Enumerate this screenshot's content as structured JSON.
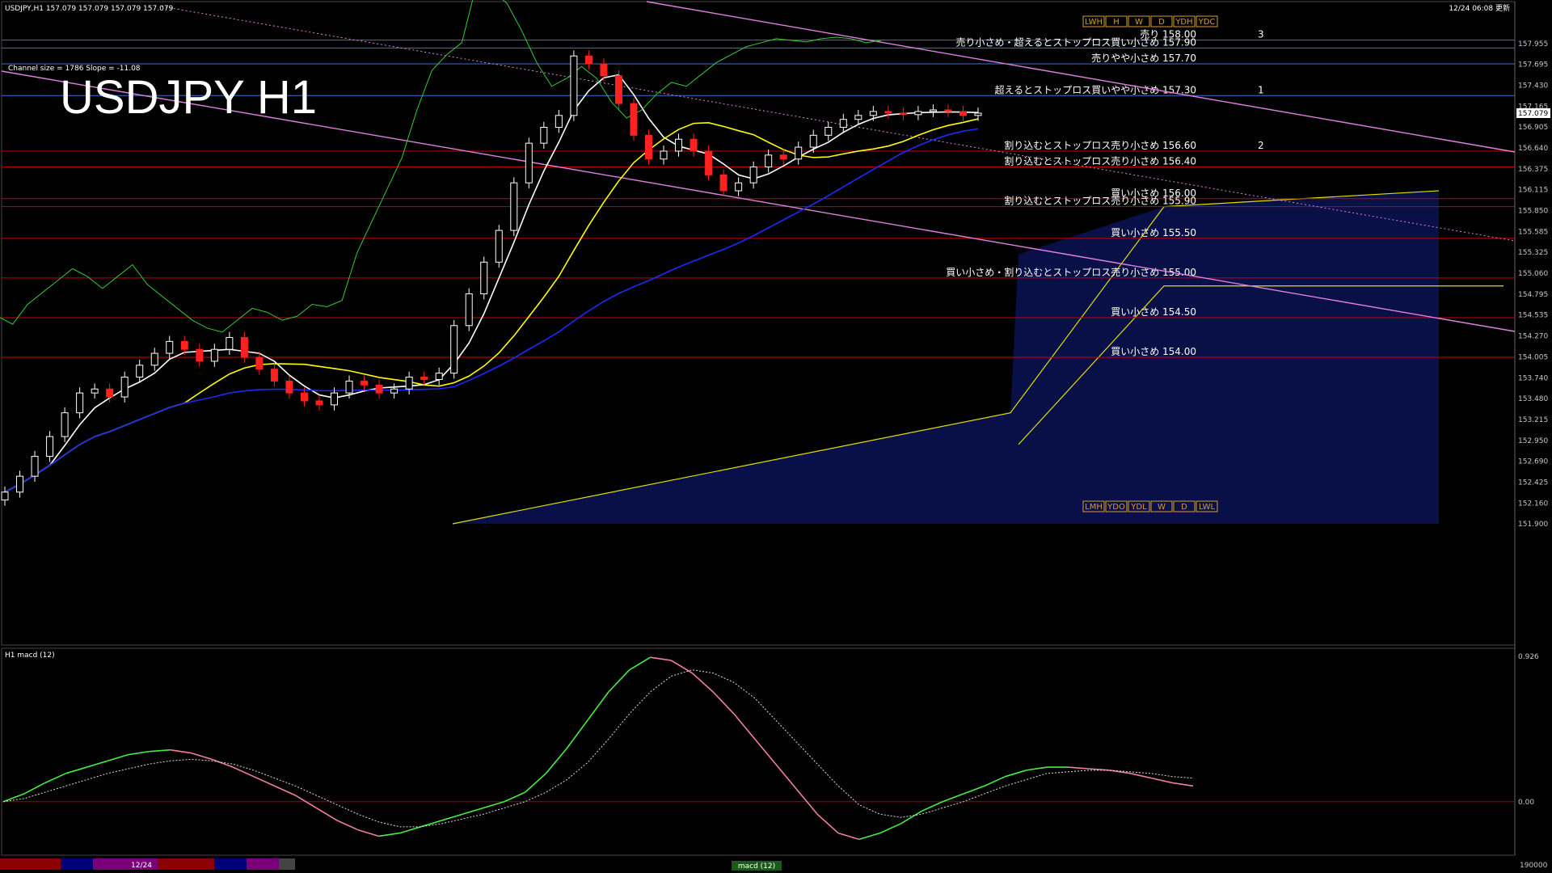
{
  "header": {
    "symbol_line": "USDJPY,H1  157.079 157.079 157.079 157.079",
    "datetime": "12/24 06:08 更新",
    "channel_info": "Channel size = 1786 Slope = -11.08",
    "big_title": "USDJPY H1"
  },
  "indicator_window": {
    "label": "H1  macd (12)"
  },
  "bottom_bar": {
    "date_label": "12/24",
    "macd_tab": "macd (12)",
    "volume_axis": "190000"
  },
  "colors": {
    "candle_up": "#ffffff",
    "candle_down": "#ff2020",
    "ma_fast": "#ffffff",
    "ma_mid": "#ffff00",
    "ma_slow": "#1a2bff",
    "chikou": "#33cc33",
    "senkou_cloud": "#1a2bcc",
    "kijun": "#e0e000",
    "channel": "#e080e0",
    "level_red": "#cc0000",
    "level_blue": "#3a6fd0",
    "macd_up": "#44ee44",
    "macd_down": "#f080a0",
    "signal": "#dddddd"
  },
  "chart_data": [
    {
      "type": "candlestick",
      "name": "USDJPY H1",
      "ylim": [
        151.9,
        158.2
      ],
      "y_ticks": [
        "157.955",
        "157.695",
        "157.430",
        "157.165",
        "156.905",
        "156.640",
        "156.375",
        "156.115",
        "155.850",
        "155.585",
        "155.325",
        "155.060",
        "154.795",
        "154.535",
        "154.270",
        "154.005",
        "153.740",
        "153.480",
        "153.215",
        "152.950",
        "152.690",
        "152.425",
        "152.160",
        "151.900"
      ],
      "current_price": "157.079",
      "levels": [
        {
          "text": "売り 158.00",
          "price": 158.0,
          "color": "#3a6fd0",
          "marker": "3"
        },
        {
          "text": "売り小さめ・超えるとストップロス買い小さめ 157.90",
          "price": 157.9,
          "color": "#3a6fd0",
          "marker": ""
        },
        {
          "text": "売りやや小さめ 157.70",
          "price": 157.7,
          "color": "#3a6fd0",
          "marker": ""
        },
        {
          "text": "超えるとストップロス買いやや小さめ 157.30",
          "price": 157.3,
          "color": "#3a6fd0",
          "marker": "1"
        },
        {
          "text": "割り込むとストップロス売り小さめ 156.60",
          "price": 156.6,
          "color": "#cc0000",
          "marker": "2"
        },
        {
          "text": "割り込むとストップロス売り小さめ 156.40",
          "price": 156.4,
          "color": "#cc0000",
          "marker": ""
        },
        {
          "text": "買い小さめ 156.00",
          "price": 156.0,
          "color": "#cc0000",
          "marker": ""
        },
        {
          "text": "割り込むとストップロス売り小さめ 155.90",
          "price": 155.9,
          "color": "#cc0000",
          "marker": ""
        },
        {
          "text": "買い小さめ 155.50",
          "price": 155.5,
          "color": "#cc0000",
          "marker": ""
        },
        {
          "text": "買い小さめ・割り込むとストップロス売り小さめ 155.00",
          "price": 155.0,
          "color": "#cc0000",
          "marker": ""
        },
        {
          "text": "買い小さめ 154.50",
          "price": 154.5,
          "color": "#cc0000",
          "marker": ""
        },
        {
          "text": "買い小さめ 154.00",
          "price": 154.0,
          "color": "#cc0000",
          "marker": ""
        }
      ],
      "markers": [
        "LWH",
        "H",
        "W",
        "D",
        "YDH",
        "YDC",
        "LMH",
        "YDO",
        "YDL",
        "W",
        "D",
        "LWL"
      ],
      "closes": [
        152.3,
        152.5,
        152.75,
        153.0,
        153.3,
        153.55,
        153.6,
        153.5,
        153.75,
        153.9,
        154.05,
        154.2,
        154.1,
        153.95,
        154.1,
        154.25,
        154.0,
        153.85,
        153.7,
        153.55,
        153.45,
        153.4,
        153.55,
        153.7,
        153.65,
        153.55,
        153.6,
        153.75,
        153.72,
        153.8,
        154.4,
        154.8,
        155.2,
        155.6,
        156.2,
        156.7,
        156.9,
        157.05,
        157.8,
        157.7,
        157.55,
        157.2,
        156.8,
        156.5,
        156.6,
        156.75,
        156.6,
        156.3,
        156.1,
        156.2,
        156.4,
        156.55,
        156.5,
        156.65,
        156.8,
        156.9,
        157.0,
        157.05,
        157.1,
        157.08,
        157.06,
        157.1,
        157.12,
        157.1,
        157.05,
        157.079
      ]
    },
    {
      "type": "line",
      "name": "macd (12)",
      "y_ticks": [
        "0.926",
        "0.00"
      ],
      "ylim": [
        -0.3,
        0.926
      ],
      "series": [
        {
          "values": [
            0.0,
            0.05,
            0.12,
            0.18,
            0.22,
            0.26,
            0.3,
            0.32,
            0.33,
            0.31,
            0.27,
            0.22,
            0.16,
            0.1,
            0.04,
            -0.04,
            -0.12,
            -0.18,
            -0.22,
            -0.2,
            -0.16,
            -0.12,
            -0.08,
            -0.04,
            0.0,
            0.06,
            0.18,
            0.34,
            0.52,
            0.7,
            0.84,
            0.92,
            0.9,
            0.82,
            0.7,
            0.56,
            0.4,
            0.24,
            0.08,
            -0.08,
            -0.2,
            -0.24,
            -0.2,
            -0.14,
            -0.06,
            0.0,
            0.05,
            0.1,
            0.16,
            0.2,
            0.22,
            0.22,
            0.21,
            0.2,
            0.18,
            0.15,
            0.12,
            0.1
          ]
        },
        {
          "values": [
            0.0,
            0.02,
            0.06,
            0.1,
            0.14,
            0.18,
            0.21,
            0.24,
            0.26,
            0.27,
            0.26,
            0.24,
            0.2,
            0.15,
            0.1,
            0.04,
            -0.02,
            -0.08,
            -0.13,
            -0.16,
            -0.16,
            -0.14,
            -0.11,
            -0.08,
            -0.04,
            0.0,
            0.06,
            0.14,
            0.25,
            0.4,
            0.56,
            0.7,
            0.8,
            0.84,
            0.82,
            0.76,
            0.66,
            0.52,
            0.38,
            0.24,
            0.1,
            -0.02,
            -0.08,
            -0.1,
            -0.08,
            -0.04,
            0.0,
            0.05,
            0.1,
            0.14,
            0.18,
            0.19,
            0.2,
            0.2,
            0.19,
            0.18,
            0.16,
            0.15
          ]
        }
      ]
    }
  ]
}
